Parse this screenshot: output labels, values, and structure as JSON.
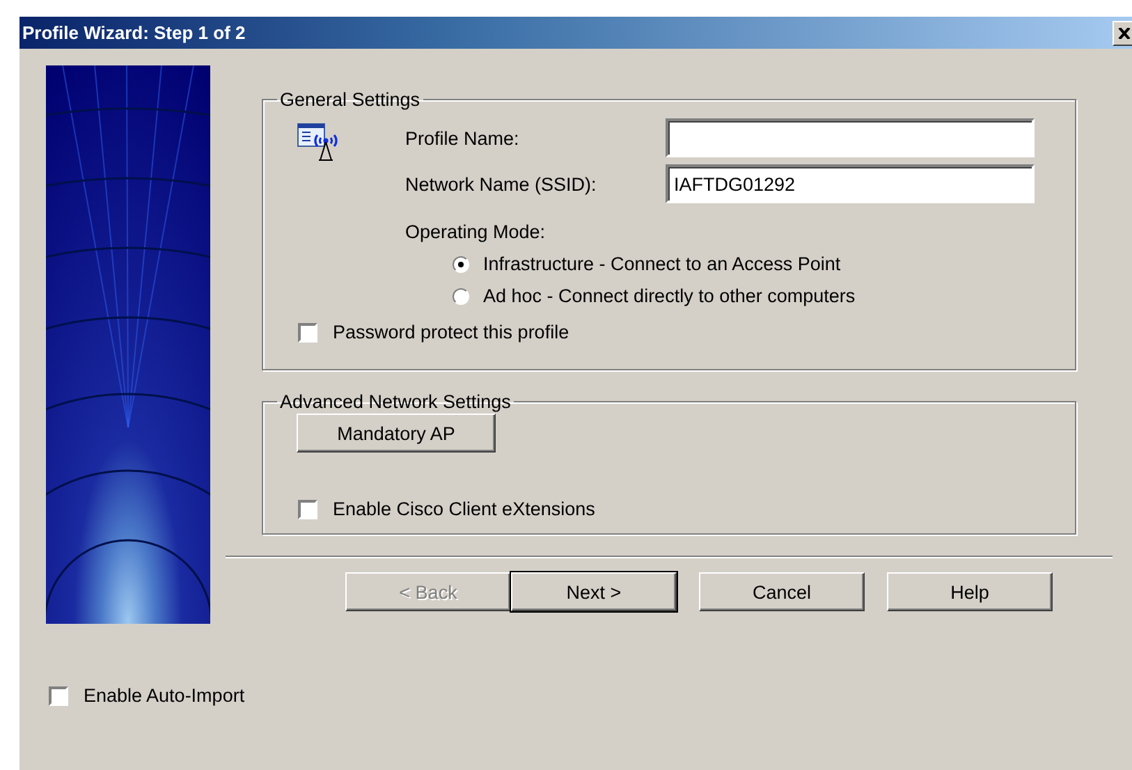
{
  "window": {
    "title": "Profile Wizard: Step 1 of 2"
  },
  "general_settings": {
    "title": "General Settings",
    "profile_name": {
      "label": "Profile Name:"
    },
    "network_name": {
      "label": "Network Name (SSID):",
      "value": "IAFTDG01292"
    },
    "operating_mode": {
      "label": "Operating Mode:",
      "options": [
        {
          "label": "Infrastructure - Connect to an Access Point",
          "selected": true
        },
        {
          "label": "Ad hoc - Connect directly to other computers",
          "selected": false
        }
      ]
    },
    "password_protect": {
      "label": "Password protect this profile",
      "checked": false
    }
  },
  "advanced_settings": {
    "title": "Advanced Network Settings",
    "mandatory_ap_button": "Mandatory AP",
    "cisco_extensions": {
      "label": "Enable Cisco Client eXtensions",
      "checked": false
    }
  },
  "buttons": [
    {
      "label": "< Back",
      "disabled": true,
      "default": false
    },
    {
      "label": "Next >",
      "disabled": false,
      "default": true
    },
    {
      "label": "Cancel",
      "disabled": false,
      "default": false
    },
    {
      "label": "Help",
      "disabled": false,
      "default": false
    }
  ],
  "auto_import": {
    "label": "Enable Auto-Import",
    "checked": false
  }
}
